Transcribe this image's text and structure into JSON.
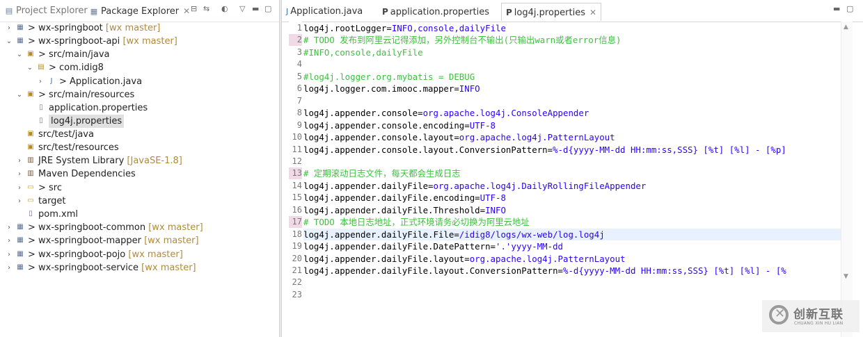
{
  "left_tabs": {
    "project_explorer": "Project Explorer",
    "package_explorer": "Package Explorer"
  },
  "tree": [
    {
      "arrow": "›",
      "icon": "project-icon",
      "glyph": "▦",
      "text": "> wx-springboot",
      "branch": "[wx master]"
    },
    {
      "arrow": "⌄",
      "icon": "project-icon",
      "glyph": "▦",
      "text": "> wx-springboot-api",
      "branch": "[wx master]"
    },
    {
      "arrow": "⌄",
      "icon": "source-folder-icon",
      "glyph": "▣",
      "text": "> src/main/java",
      "branch": ""
    },
    {
      "arrow": "⌄",
      "icon": "package-icon",
      "glyph": "▤",
      "text": "> com.idig8",
      "branch": ""
    },
    {
      "arrow": "›",
      "icon": "java-file-icon",
      "glyph": "J",
      "text": "> Application.java",
      "branch": ""
    },
    {
      "arrow": "⌄",
      "icon": "source-folder-icon",
      "glyph": "▣",
      "text": "> src/main/resources",
      "branch": ""
    },
    {
      "arrow": "",
      "icon": "properties-file-icon",
      "glyph": "▯",
      "text": "application.properties",
      "branch": ""
    },
    {
      "arrow": "",
      "icon": "properties-file-icon",
      "glyph": "▯",
      "text": "log4j.properties",
      "branch": ""
    },
    {
      "arrow": "",
      "icon": "source-folder-icon",
      "glyph": "▣",
      "text": "src/test/java",
      "branch": ""
    },
    {
      "arrow": "",
      "icon": "source-folder-icon",
      "glyph": "▣",
      "text": "src/test/resources",
      "branch": ""
    },
    {
      "arrow": "›",
      "icon": "library-icon",
      "glyph": "▥",
      "text": "JRE System Library",
      "branch": "[JavaSE-1.8]"
    },
    {
      "arrow": "›",
      "icon": "library-icon",
      "glyph": "▥",
      "text": "Maven Dependencies",
      "branch": ""
    },
    {
      "arrow": "›",
      "icon": "folder-icon",
      "glyph": "▭",
      "text": "> src",
      "branch": ""
    },
    {
      "arrow": "›",
      "icon": "folder-icon",
      "glyph": "▭",
      "text": "target",
      "branch": ""
    },
    {
      "arrow": "",
      "icon": "xml-file-icon",
      "glyph": "▯",
      "text": "pom.xml",
      "branch": ""
    },
    {
      "arrow": "›",
      "icon": "project-icon",
      "glyph": "▦",
      "text": "> wx-springboot-common",
      "branch": "[wx master]"
    },
    {
      "arrow": "›",
      "icon": "project-icon",
      "glyph": "▦",
      "text": "> wx-springboot-mapper",
      "branch": "[wx master]"
    },
    {
      "arrow": "›",
      "icon": "project-icon",
      "glyph": "▦",
      "text": "> wx-springboot-pojo",
      "branch": "[wx master]"
    },
    {
      "arrow": "›",
      "icon": "project-icon",
      "glyph": "▦",
      "text": "> wx-springboot-service",
      "branch": "[wx master]"
    }
  ],
  "editor_tabs": [
    {
      "label": "Application.java",
      "kind": "java"
    },
    {
      "label": "application.properties",
      "kind": "prop"
    },
    {
      "label": "log4j.properties",
      "kind": "prop"
    }
  ],
  "line_numbers": [
    "1",
    "2",
    "3",
    "4",
    "5",
    "6",
    "7",
    "8",
    "9",
    "10",
    "11",
    "12",
    "13",
    "14",
    "15",
    "16",
    "17",
    "18",
    "19",
    "20",
    "21",
    "22",
    "23"
  ],
  "code_lines": [
    {
      "key": "log4j.rootLogger=",
      "val": "INFO,console,dailyFile",
      "comment": ""
    },
    {
      "key": "",
      "val": "",
      "comment": "# TODO 发布到阿里云记得添加，另外控制台不输出(只输出warn或者error信息)"
    },
    {
      "key": "",
      "val": "",
      "comment": "#INFO,console,dailyFile"
    },
    {
      "key": "",
      "val": "",
      "comment": ""
    },
    {
      "key": "",
      "val": "",
      "comment": "#log4j.logger.org.mybatis = DEBUG"
    },
    {
      "key": "log4j.logger.com.imooc.mapper=",
      "val": "INFO",
      "comment": ""
    },
    {
      "key": "",
      "val": "",
      "comment": ""
    },
    {
      "key": "log4j.appender.console=",
      "val": "org.apache.log4j.ConsoleAppender",
      "comment": ""
    },
    {
      "key": "log4j.appender.console.encoding=",
      "val": "UTF-8",
      "comment": ""
    },
    {
      "key": "log4j.appender.console.layout=",
      "val": "org.apache.log4j.PatternLayout",
      "comment": ""
    },
    {
      "key": "log4j.appender.console.layout.ConversionPattern=",
      "val": "%-d{yyyy-MM-dd HH:mm:ss,SSS} [%t] [%l] - [%p]",
      "comment": ""
    },
    {
      "key": "",
      "val": "",
      "comment": ""
    },
    {
      "key": "",
      "val": "",
      "comment": "# 定期滚动日志文件，每天都会生成日志"
    },
    {
      "key": "log4j.appender.dailyFile=",
      "val": "org.apache.log4j.DailyRollingFileAppender",
      "comment": ""
    },
    {
      "key": "log4j.appender.dailyFile.encoding=",
      "val": "UTF-8",
      "comment": ""
    },
    {
      "key": "log4j.appender.dailyFile.Threshold=",
      "val": "INFO",
      "comment": ""
    },
    {
      "key": "",
      "val": "",
      "comment": "# TODO 本地日志地址，正式环境请务必切换为阿里云地址"
    },
    {
      "key": "log4j.appender.dailyFile.File=",
      "val": "/idig8/logs/wx-web/log.log4j",
      "comment": ""
    },
    {
      "key": "log4j.appender.dailyFile.DatePattern=",
      "val": "'.'yyyy-MM-dd",
      "comment": ""
    },
    {
      "key": "log4j.appender.dailyFile.layout=",
      "val": "org.apache.log4j.PatternLayout",
      "comment": ""
    },
    {
      "key": "log4j.appender.dailyFile.layout.ConversionPattern=",
      "val": "%-d{yyyy-MM-dd HH:mm:ss,SSS} [%t] [%l] - [%",
      "comment": ""
    },
    {
      "key": "",
      "val": "",
      "comment": ""
    },
    {
      "key": "",
      "val": "",
      "comment": ""
    }
  ],
  "watermark": {
    "cn": "创新互联",
    "en": "CHUANG XIN HU LIAN"
  },
  "colors": {
    "comment": "#3fbf3f",
    "value": "#2a00ff",
    "current_line": "#e8f2fe",
    "marker": "#f2d9e6"
  }
}
